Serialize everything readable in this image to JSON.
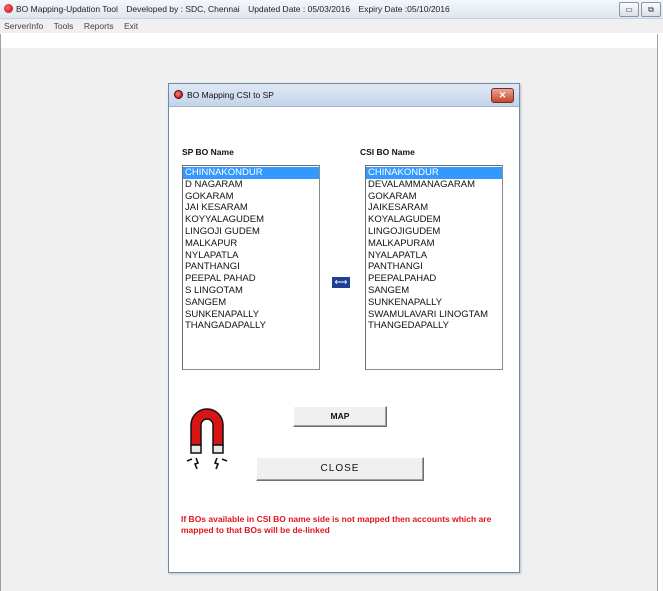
{
  "window": {
    "title_parts": [
      "BO Mapping-Updation Tool",
      "Developed by : SDC, Chennai",
      "Updated Date : 05/03/2016",
      "Expiry Date :05/10/2016"
    ],
    "controls": {
      "minimize": "▭",
      "restore": "⧉"
    }
  },
  "menu": [
    "ServerInfo",
    "Tools",
    "Reports",
    "Exit"
  ],
  "dialog": {
    "title": "BO Mapping CSI to SP",
    "close_glyph": "✕",
    "sp_label": "SP BO Name",
    "csi_label": "CSI BO Name",
    "sp_items": [
      "CHINNAKONDUR",
      "D NAGARAM",
      "GOKARAM",
      "JAI KESARAM",
      "KOYYALAGUDEM",
      "LINGOJI GUDEM",
      "MALKAPUR",
      "NYLAPATLA",
      "PANTHANGI",
      "PEEPAL PAHAD",
      "S LINGOTAM",
      "SANGEM",
      "SUNKENAPALLY",
      "THANGADAPALLY"
    ],
    "csi_items": [
      "CHINAKONDUR",
      "DEVALAMMANAGARAM",
      "GOKARAM",
      "JAIKESARAM",
      "KOYALAGUDEM",
      "LINGOJIGUDEM",
      "MALKAPURAM",
      "NYALAPATLA",
      "PANTHANGI",
      "PEEPALPAHAD",
      "SANGEM",
      "SUNKENAPALLY",
      "SWAMULAVARI LINOGTAM",
      "THANGEDAPALLY"
    ],
    "selected_index": 0,
    "swap_glyph": "⟷",
    "map_label": "MAP",
    "close_label": "CLOSE",
    "note": "If BOs available in CSI BO name side is not mapped then accounts which are mapped to that BOs will be de-linked"
  },
  "colors": {
    "selection": "#3399ff",
    "note": "#e0151e",
    "swap": "#1e3f97"
  }
}
